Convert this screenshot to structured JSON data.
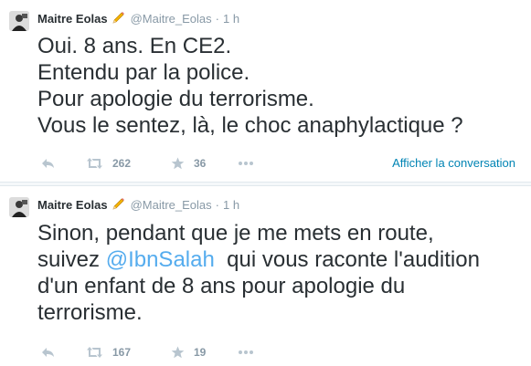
{
  "tweets": [
    {
      "author": {
        "name": "Maitre Eolas",
        "handle": "@Maitre_Eolas",
        "badge_icon": "pencil-icon"
      },
      "time": "1 h",
      "lines": [
        "Oui. 8 ans. En CE2.",
        "Entendu par la police.",
        "Pour apologie du terrorisme.",
        "Vous le sentez, là, le choc anaphylactique ?"
      ],
      "retweets": "262",
      "favorites": "36",
      "conversation_link": "Afficher la conversation"
    },
    {
      "author": {
        "name": "Maitre Eolas",
        "handle": "@Maitre_Eolas",
        "badge_icon": "pencil-icon"
      },
      "time": "1 h",
      "lines": [
        "Sinon, pendant que je me mets en route,",
        "suivez",
        "@IbnSalah",
        "qui vous raconte l'audition",
        "d'un enfant de 8 ans pour apologie du",
        "terrorisme."
      ],
      "retweets": "167",
      "favorites": "19"
    }
  ],
  "colors": {
    "text": "#292f33",
    "muted": "#8899a6",
    "mention": "#55acee",
    "link": "#0084b4",
    "separator": "#f5f8fa"
  }
}
